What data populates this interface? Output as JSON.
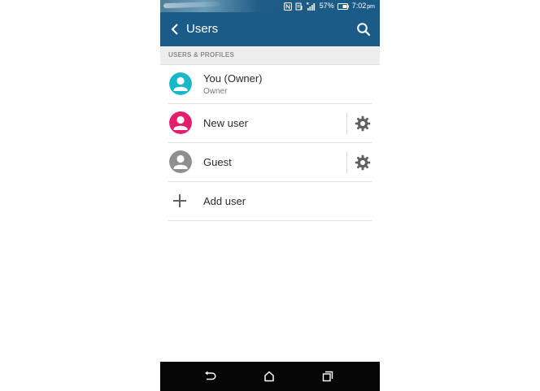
{
  "status_bar": {
    "battery_text": "57%",
    "time": "7:02",
    "time_suffix": "pm",
    "icons": [
      "nfc-icon",
      "data-saver-icon",
      "signal-icon",
      "battery-icon"
    ]
  },
  "app_bar": {
    "title": "Users",
    "back_icon": "chevron-left-icon",
    "search_icon": "search-icon",
    "color": "#1a5b87"
  },
  "section": {
    "header": "USERS & PROFILES"
  },
  "users": [
    {
      "name": "You (Owner)",
      "subtitle": "Owner",
      "avatar_color": "#19b8c9",
      "icon": "person-icon",
      "has_settings": false
    },
    {
      "name": "New user",
      "avatar_color": "#e41e6d",
      "icon": "person-icon",
      "has_settings": true
    },
    {
      "name": "Guest",
      "avatar_color": "#8f8f8f",
      "icon": "person-icon",
      "has_settings": true
    }
  ],
  "add_user": {
    "label": "Add user",
    "icon": "plus-icon"
  },
  "nav_bar": {
    "icons": [
      "back-icon",
      "home-icon",
      "recents-icon"
    ]
  }
}
